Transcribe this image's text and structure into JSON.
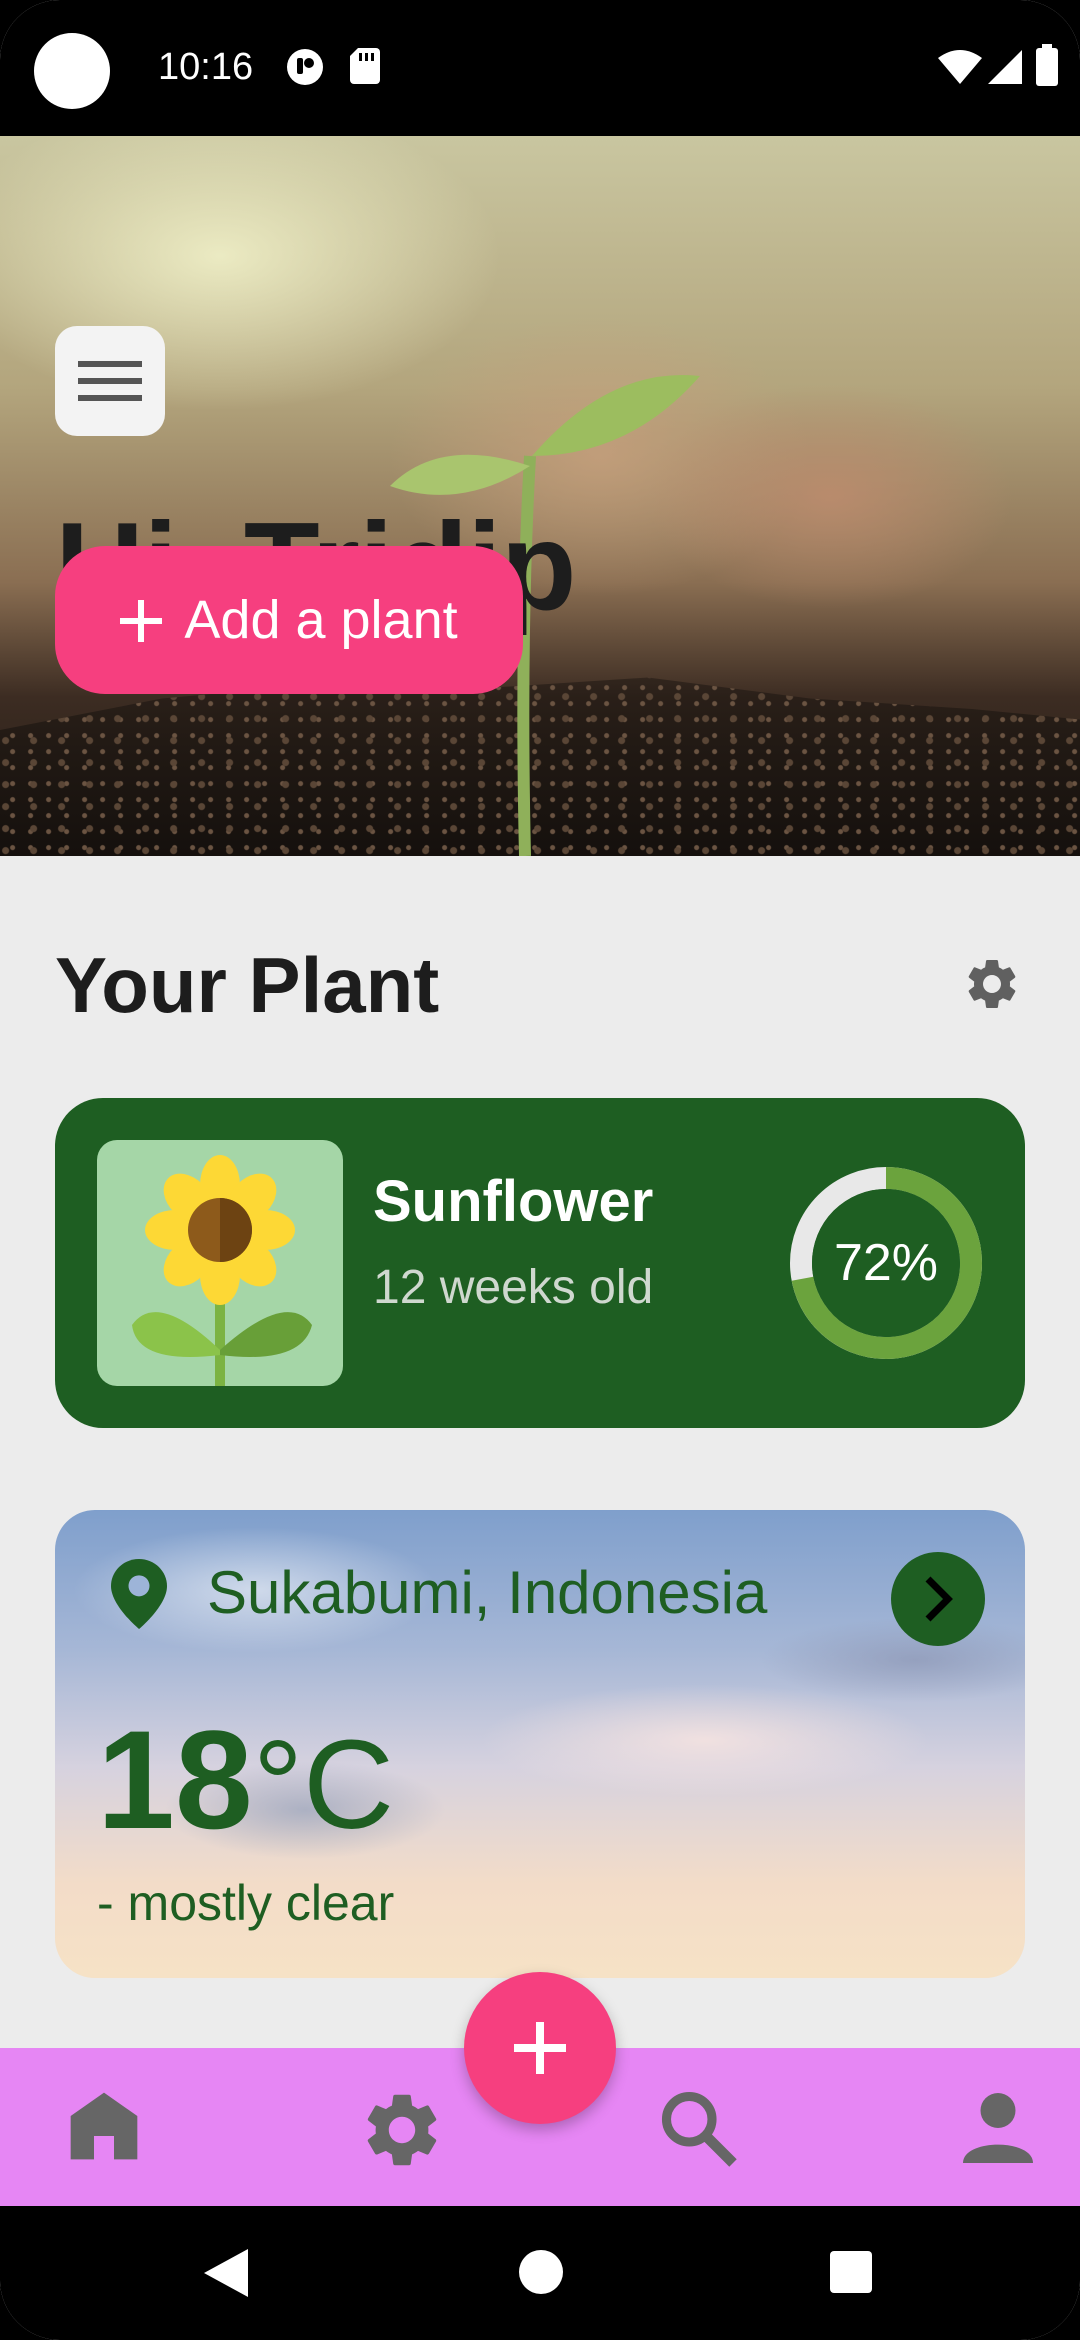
{
  "status_bar": {
    "time": "10:16"
  },
  "hero": {
    "greeting": "Hi, Tridip",
    "add_plant_label": "Add a plant",
    "add_plant_icon": "plus-icon",
    "menu_icon": "hamburger-menu-icon"
  },
  "section": {
    "title": "Your Plant",
    "settings_icon": "gear-icon"
  },
  "plant_card": {
    "name": "Sunflower",
    "age": "12 weeks old",
    "progress_text": "72%",
    "progress": 0.72,
    "image_icon": "sunflower-icon"
  },
  "weather": {
    "location": "Sukabumi, Indonesia",
    "temperature_value": "18",
    "temperature_unit": "°C",
    "description": "- mostly clear",
    "pin_icon": "location-pin-icon",
    "go_icon": "chevron-right-icon"
  },
  "bottom_nav": {
    "items": [
      {
        "id": "home",
        "icon": "home-icon"
      },
      {
        "id": "settings",
        "icon": "gear-icon"
      },
      {
        "id": "search",
        "icon": "search-icon"
      },
      {
        "id": "profile",
        "icon": "person-icon"
      }
    ],
    "fab_icon": "plus-icon"
  },
  "colors": {
    "accent_pink": "#f63f7f",
    "dark_green": "#1e5e22",
    "nav_bg": "#e686f4",
    "page_bg": "#ececec"
  }
}
